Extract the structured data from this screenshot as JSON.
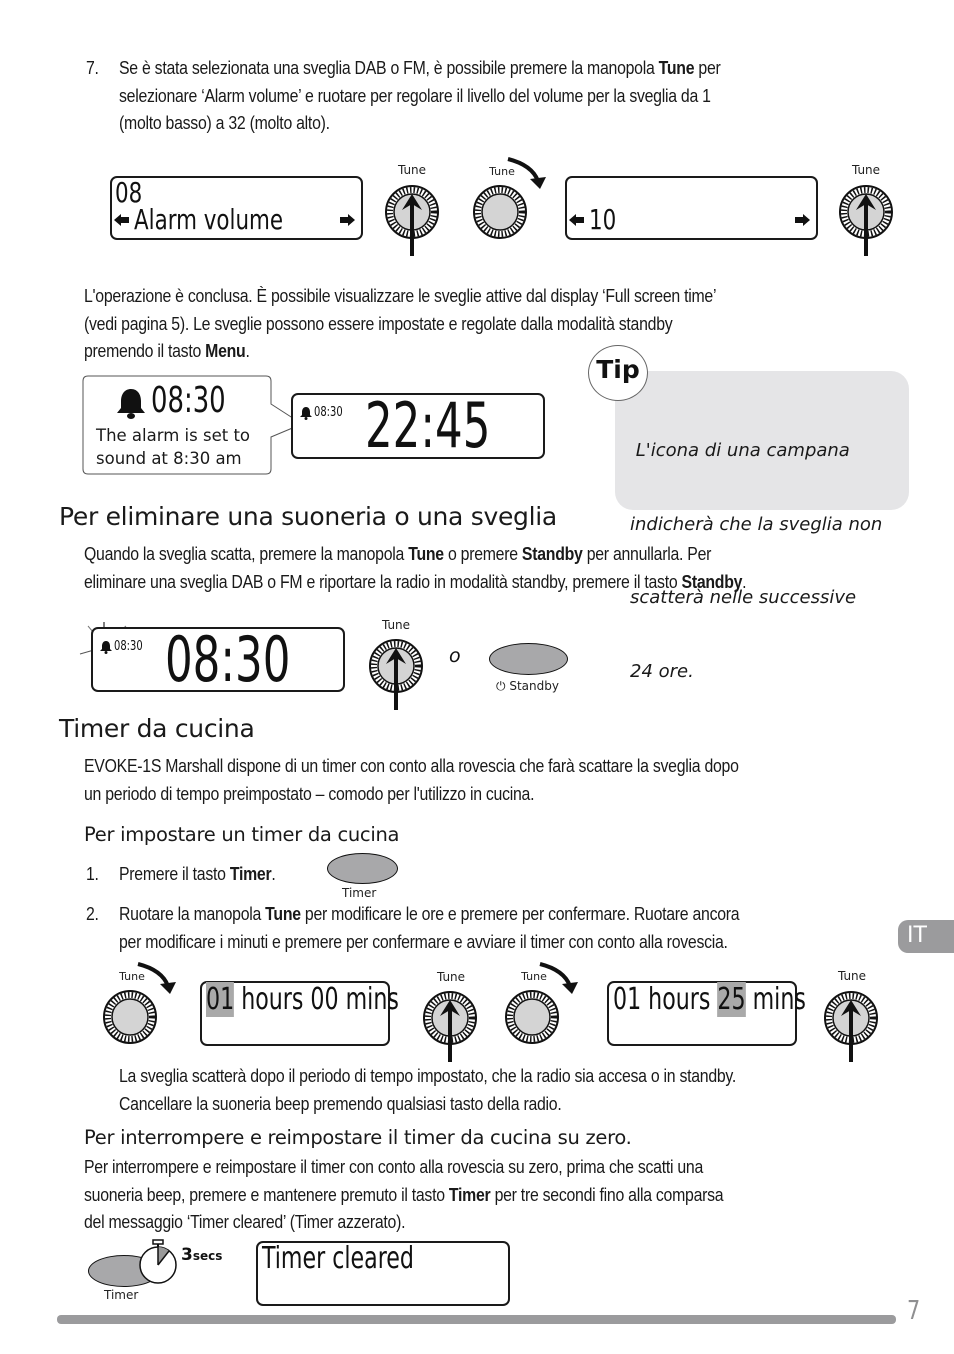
{
  "step7": {
    "number": "7.",
    "line1_a": "Se è stata selezionata una sveglia DAB o FM, è possibile premere la manopola ",
    "line1_bold": "Tune",
    "line1_b": " per",
    "line2": "selezionare ‘Alarm volume’ e ruotare per regolare il livello del volume per la sveglia da 1",
    "line3": "(molto basso) a 32 (molto alto)."
  },
  "figure1": {
    "lcd1_line1": "08",
    "lcd1_line2": "Alarm volume",
    "knob_label": "Tune",
    "lcd2_value": "10"
  },
  "conclusion": {
    "line1": "L'operazione è conclusa. È possibile visualizzare le sveglie attive dal display ‘Full screen time’",
    "line2": "(vedi pagina 5). Le sveglie possono essere impostate e regolate dalla modalità standby",
    "line3_a": "premendo il tasto ",
    "line3_bold": "Menu",
    "line3_b": "."
  },
  "figure2": {
    "callout_time": "08:30",
    "callout_line1": "The alarm is set to",
    "callout_line2": "sound at 8:30 am",
    "lcd_small_alarm": "08:30",
    "lcd_big_time": "22:45"
  },
  "tip": {
    "badge": "Tip",
    "line1": " L'icona di una campana",
    "line2": "indicherà che la sveglia non",
    "line3": "scatterà nelle successive",
    "line4": "24 ore."
  },
  "section_cancel": {
    "heading": "Per eliminare una suoneria o una sveglia",
    "line1_a": "Quando la sveglia scatta, premere la manopola ",
    "line1_b1": "Tune",
    "line1_c": " o premere ",
    "line1_b2": "Standby",
    "line1_d": " per annullarla. Per",
    "line2_a": "eliminare una sveglia DAB o FM e riportare la radio in modalità standby, premere il tasto ",
    "line2_bold": "Standby",
    "line2_b": "."
  },
  "figure3": {
    "lcd_small_alarm": "08:30",
    "lcd_big_time": "08:30",
    "knob_label": "Tune",
    "or_text": "o",
    "standby_label": "Standby"
  },
  "section_timer": {
    "heading": "Timer da cucina",
    "line1": "EVOKE-1S Marshall dispone di un timer con conto alla rovescia che farà scattare la sveglia dopo",
    "line2": "un periodo di tempo preimpostato – comodo per l'utilizzo in cucina."
  },
  "section_set_timer": {
    "heading": "Per impostare un timer da cucina",
    "step1_num": "1.",
    "step1_a": "Premere il tasto ",
    "step1_bold": "Timer",
    "step1_b": ".",
    "timer_button_label": "Timer",
    "step2_num": "2.",
    "step2_line1_a": "Ruotare la manopola ",
    "step2_line1_bold": "Tune",
    "step2_line1_b": " per modificare le ore e premere per confermare. Ruotare ancora",
    "step2_line2": "per modificare i minuti e premere per confermare e avviare il timer con conto alla rovescia."
  },
  "figure4": {
    "knob_label": "Tune",
    "lcd1_hours": "01",
    "lcd1_rest": " hours 00 mins",
    "lcd2_prefix": "01 hours ",
    "lcd2_mins": "25",
    "lcd2_suffix": " mins"
  },
  "after_timer": {
    "line1": "La sveglia scatterà dopo il periodo di tempo impostato, che la radio sia accesa o in standby.",
    "line2": "Cancellare la suoneria beep premendo qualsiasi tasto della radio."
  },
  "section_reset": {
    "heading": "Per interrompere e reimpostare il timer da cucina su zero.",
    "line1": "Per interrompere e reimpostare il timer con conto alla rovescia su zero, prima che scatti una",
    "line2_a": "suoneria beep, premere e mantenere premuto il tasto ",
    "line2_bold": "Timer",
    "line2_b": " per tre secondi fino alla comparsa",
    "line3": "del messaggio ‘Timer cleared’ (Timer azzerato)."
  },
  "figure5": {
    "secs_number": "3",
    "secs_unit": "secs",
    "timer_label": "Timer",
    "lcd_text": "Timer cleared"
  },
  "footer": {
    "language_tab": "IT",
    "page_number": "7"
  },
  "colors": {
    "tip_background": "#e5e5e7",
    "knob_fill": "#d4d4d4",
    "button_fill": "#a8a8aa",
    "highlight": "#a9a9a9",
    "page_bar": "#9b9b9d"
  }
}
